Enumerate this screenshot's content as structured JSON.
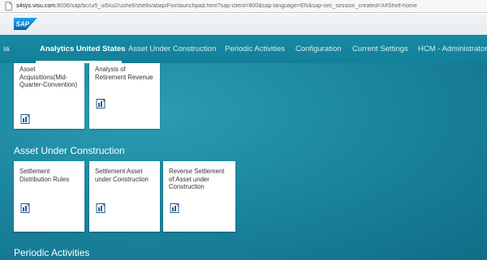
{
  "browser": {
    "url_host": "s4sys.visu.com",
    "url_path": ":8036/sap/bc/ui5_ui5/ui2/ushell/shells/abap/Fiorilaunchpad.html?sap-client=800&sap-language=EN&sap-sec_session_created=X#Shell-home"
  },
  "shell": {
    "logo_text": "SAP"
  },
  "tabs": [
    {
      "label": "ia"
    },
    {
      "label": "Analytics United States"
    },
    {
      "label": "Asset Under Construction"
    },
    {
      "label": "Periodic Activities"
    },
    {
      "label": "Configuration"
    },
    {
      "label": "Current Settings"
    },
    {
      "label": "HCM - Administrator"
    }
  ],
  "groups": [
    {
      "title": "",
      "tiles": [
        {
          "title": "Asset Acquisitions(Mid-Quarter-Convention)",
          "icon": "report-icon"
        },
        {
          "title": "Analysis of Retirement Revenue",
          "icon": "report-icon"
        }
      ]
    },
    {
      "title": "Asset Under Construction",
      "tiles": [
        {
          "title": "Settlement Distribution Rules",
          "icon": "report-icon"
        },
        {
          "title": "Settlement Asset under Construction",
          "icon": "report-icon"
        },
        {
          "title": "Reverse Settlement of Asset under Construction",
          "icon": "report-icon"
        }
      ]
    },
    {
      "title": "Periodic Activities",
      "tiles": []
    }
  ],
  "colors": {
    "accent": "#1c87a1",
    "logo_blue": "#0a6ed1",
    "icon_blue": "#2a5d8f"
  }
}
